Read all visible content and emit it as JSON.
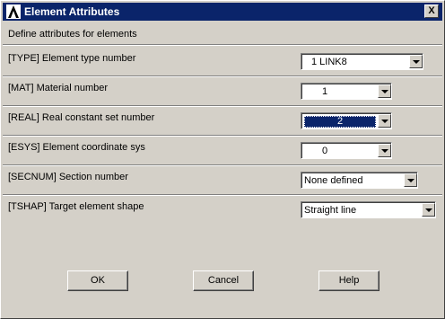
{
  "window": {
    "title": "Element Attributes",
    "icon": "ansys-logo-icon",
    "close_label": "X",
    "subtitle": "Define attributes for elements"
  },
  "fields": {
    "type": {
      "label": "[TYPE]  Element type number",
      "value": "1    LINK8"
    },
    "mat": {
      "label": "[MAT]   Material number",
      "value": "1"
    },
    "real": {
      "label": "[REAL]   Real constant set number",
      "value": "2"
    },
    "esys": {
      "label": "[ESYS]  Element coordinate sys",
      "value": "0"
    },
    "secnum": {
      "label": "[SECNUM]  Section number",
      "value": "None defined"
    },
    "tshap": {
      "label": "[TSHAP]  Target element shape",
      "value": "Straight line"
    }
  },
  "buttons": {
    "ok": "OK",
    "cancel": "Cancel",
    "help": "Help"
  },
  "colors": {
    "titlebar": "#0a246a",
    "face": "#d4d0c8",
    "selection": "#0a246a"
  }
}
